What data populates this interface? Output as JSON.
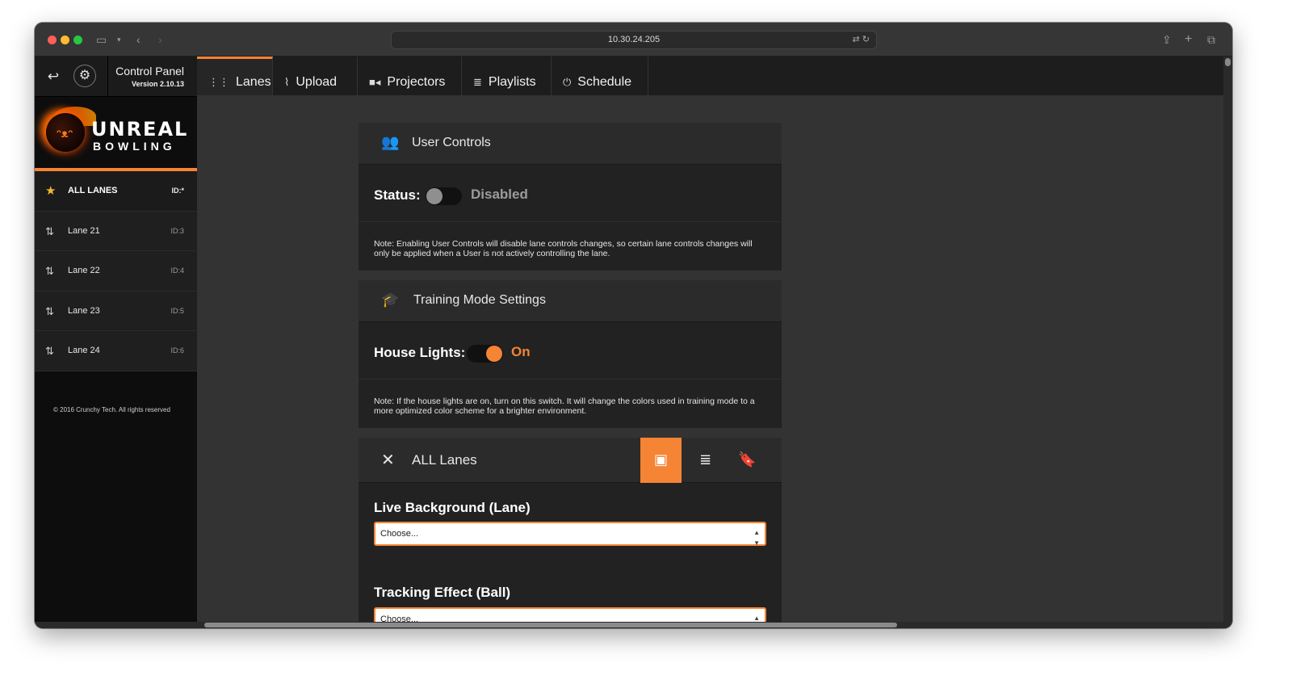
{
  "browser": {
    "url": "10.30.24.205"
  },
  "sidebar": {
    "control_panel_title": "Control Panel",
    "version": "Version 2.10.13",
    "logo_line1": "UNREAL",
    "logo_line2": "BOWLING",
    "lanes": [
      {
        "label": "ALL LANES",
        "id": "ID:*",
        "icon": "star-icon",
        "active": true
      },
      {
        "label": "Lane 21",
        "id": "ID:3",
        "icon": "sliders-icon",
        "active": false
      },
      {
        "label": "Lane 22",
        "id": "ID:4",
        "icon": "sliders-icon",
        "active": false
      },
      {
        "label": "Lane 23",
        "id": "ID:5",
        "icon": "sliders-icon",
        "active": false
      },
      {
        "label": "Lane 24",
        "id": "ID:6",
        "icon": "sliders-icon",
        "active": false
      }
    ],
    "copyright": "© 2016 Crunchy Tech. All rights reserved"
  },
  "nav": {
    "tabs": [
      {
        "label": "Lanes",
        "icon": "grid-icon",
        "active": true
      },
      {
        "label": "Upload",
        "icon": "paperclip-icon",
        "active": false
      },
      {
        "label": "Projectors",
        "icon": "video-camera-icon",
        "active": false
      },
      {
        "label": "Playlists",
        "icon": "database-icon",
        "active": false
      },
      {
        "label": "Schedule",
        "icon": "power-icon",
        "active": false
      }
    ]
  },
  "user_controls": {
    "title": "User Controls",
    "status_label": "Status:",
    "status_value": "Disabled",
    "enabled": false,
    "note": "Note: Enabling User Controls will disable lane controls changes, so certain lane controls changes will only be applied when a User is not actively controlling the lane."
  },
  "training_mode": {
    "title": "Training Mode Settings",
    "house_lights_label": "House Lights:",
    "house_lights_value": "On",
    "enabled": true,
    "note": "Note: If the house lights are on, turn on this switch. It will change the colors used in training mode to a more optimized color scheme for a brighter environment."
  },
  "all_lanes": {
    "title": "ALL Lanes",
    "buttons": [
      "film-icon",
      "database-icon",
      "bookmark-icon"
    ],
    "live_background_label": "Live Background (Lane)",
    "live_background_value": "Choose...",
    "tracking_effect_label": "Tracking Effect (Ball)",
    "tracking_effect_value": "Choose..."
  },
  "colors": {
    "accent": "#f58434",
    "sidebar_bg": "#0d0d0d",
    "content_bg": "#333333"
  }
}
